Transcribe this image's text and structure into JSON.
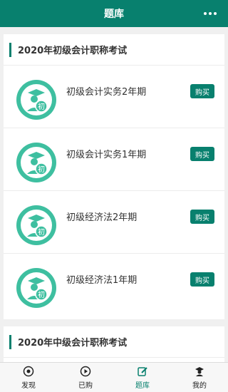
{
  "header": {
    "title": "题库"
  },
  "sections": [
    {
      "title": "2020年初级会计职称考试",
      "courses": [
        {
          "name": "初级会计实务2年期",
          "badge": "初",
          "buy_label": "购买"
        },
        {
          "name": "初级会计实务1年期",
          "badge": "初",
          "buy_label": "购买"
        },
        {
          "name": "初级经济法2年期",
          "badge": "初",
          "buy_label": "购买"
        },
        {
          "name": "初级经济法1年期",
          "badge": "初",
          "buy_label": "购买"
        }
      ]
    },
    {
      "title": "2020年中级会计职称考试"
    }
  ],
  "tabs": [
    {
      "label": "发现",
      "icon": "discover-icon"
    },
    {
      "label": "已购",
      "icon": "play-icon"
    },
    {
      "label": "题库",
      "icon": "edit-icon"
    },
    {
      "label": "我的",
      "icon": "user-icon"
    }
  ],
  "colors": {
    "primary": "#08806e",
    "icon_bg": "#3ebfa0"
  }
}
